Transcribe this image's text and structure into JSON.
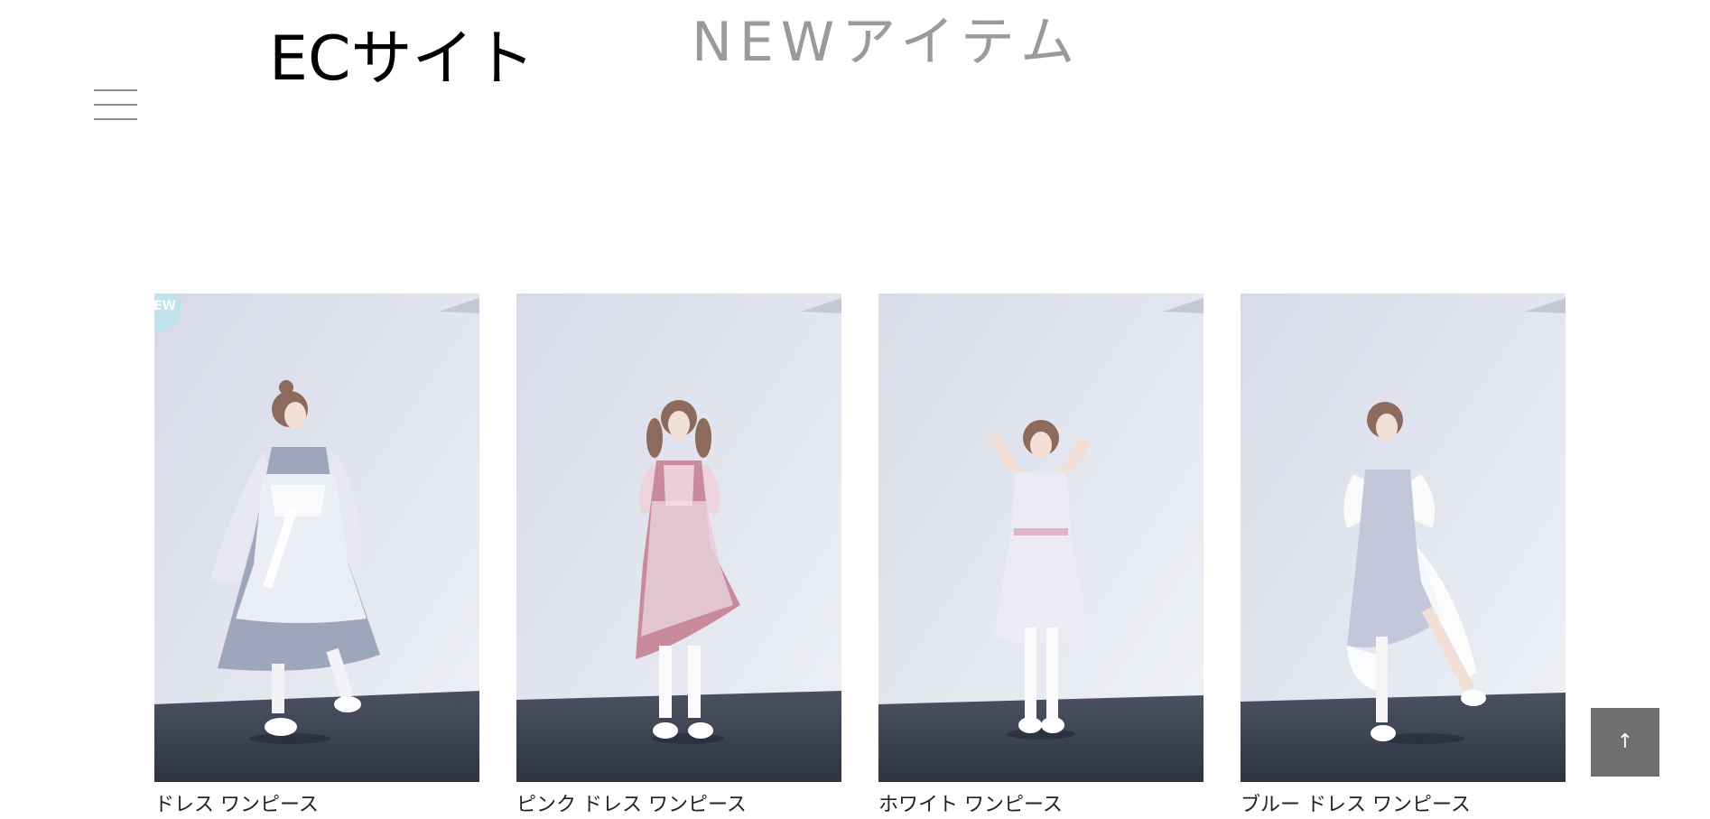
{
  "header": {
    "site_title": "ECサイト",
    "section_title": "NEWアイテム",
    "menu_icon": "hamburger-menu-icon"
  },
  "products": [
    {
      "badge": "NEW",
      "name": "ドレス ワンピース",
      "dress_color": "#9ea6bb",
      "accent_color": "#ffffff"
    },
    {
      "badge": "",
      "name": "ピンク ドレス ワンピース",
      "dress_color": "#c98b9c",
      "accent_color": "#f5dfe8"
    },
    {
      "badge": "",
      "name": "ホワイト ワンピース",
      "dress_color": "#eceaf2",
      "accent_color": "#d9a9bf"
    },
    {
      "badge": "",
      "name": "ブルー ドレス ワンピース",
      "dress_color": "#c3c7d9",
      "accent_color": "#ffffff"
    }
  ],
  "back_to_top": {
    "label": "↑",
    "icon": "arrow-up-icon"
  },
  "colors": {
    "background": "#ffffff",
    "wall": "#dfe2ec",
    "floor": "#3a4252",
    "section_title": "#9a9a9a",
    "back_to_top_bg": "#6f6f6f"
  }
}
